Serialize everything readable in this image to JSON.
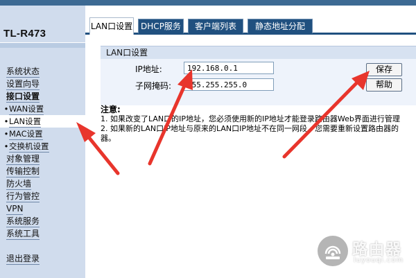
{
  "brand": {
    "model": "TL-R473"
  },
  "sidebar": {
    "items": [
      {
        "label": "系统状态"
      },
      {
        "label": "设置向导"
      },
      {
        "label": "接口设置"
      },
      {
        "label": "WAN设置"
      },
      {
        "label": "LAN设置"
      },
      {
        "label": "MAC设置"
      },
      {
        "label": "交换机设置"
      },
      {
        "label": "对象管理"
      },
      {
        "label": "传输控制"
      },
      {
        "label": "防火墙"
      },
      {
        "label": "行为管控"
      },
      {
        "label": "VPN"
      },
      {
        "label": "系统服务"
      },
      {
        "label": "系统工具"
      },
      {
        "label": "退出登录"
      }
    ]
  },
  "tabs": [
    {
      "label": "LAN口设置"
    },
    {
      "label": "DHCP服务"
    },
    {
      "label": "客户端列表"
    },
    {
      "label": "静态地址分配"
    }
  ],
  "panel": {
    "title": "LAN口设置",
    "ip_label": "IP地址:",
    "ip_value": "192.168.0.1",
    "mask_label": "子网掩码:",
    "mask_value": "255.255.255.0",
    "save_label": "保存",
    "help_label": "帮助"
  },
  "notes": {
    "title": "注意:",
    "line1": "1. 如果改变了LAN口的IP地址，您必须使用新的IP地址才能登录路由器Web界面进行管理",
    "line2": "2. 如果新的LAN口IP地址与原来的LAN口IP地址不在同一网段，您需要重新设置路由器的",
    "line3": "器。"
  },
  "watermark": {
    "cn": "路由器",
    "en": "luyouqi.com"
  },
  "colors": {
    "tab_dark": "#20507f",
    "sidebar_bg": "#d0dced",
    "arrow_red": "#e8352c"
  }
}
